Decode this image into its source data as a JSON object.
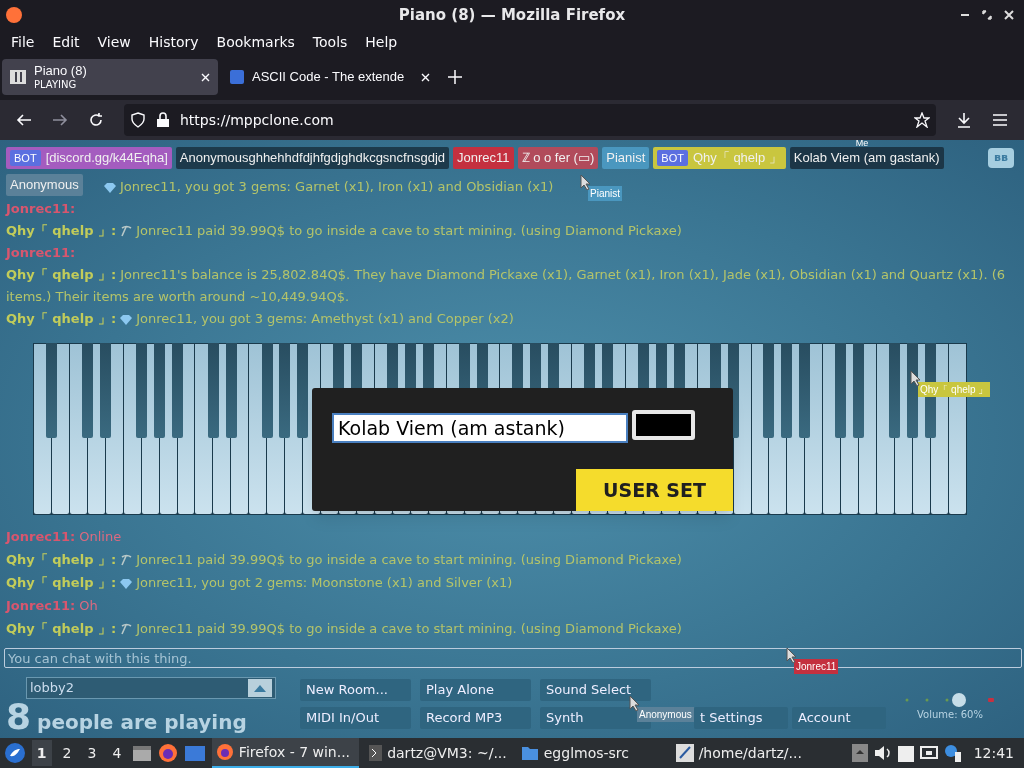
{
  "window": {
    "title": "Piano (8) — Mozilla Firefox"
  },
  "menu": [
    "File",
    "Edit",
    "View",
    "History",
    "Bookmarks",
    "Tools",
    "Help"
  ],
  "tabs": [
    {
      "title": "Piano (8)",
      "subtitle": "PLAYING",
      "selected": true
    },
    {
      "title": "ASCII Code - The extende",
      "selected": false
    }
  ],
  "url": "https://mppclone.com",
  "users": [
    {
      "name": "[discord.gg/k44Eqha]",
      "badge": "BOT",
      "color": "#a45cbf"
    },
    {
      "name": "Anonymousghhehhdfdjhfgdjghdkcgsncfnsgdjd",
      "color": "#1d3a4b"
    },
    {
      "name": "Jonrec11",
      "color": "#c4303f"
    },
    {
      "name": "ℤ o o fer (▭)",
      "color": "#b14b5b"
    },
    {
      "name": "Pianist",
      "color": "#4a97bf"
    },
    {
      "name": "Qhy「 qhelp 」",
      "badge": "BOT",
      "color": "#c9c63f"
    },
    {
      "name": "Kolab Viem (am gastank)",
      "color": "#1c3647",
      "me": "Me"
    },
    {
      "name": "Anonymous",
      "color": "#5b8199"
    }
  ],
  "user_menu_button": "ʙʙ",
  "chat_above": [
    {
      "kind": "gems",
      "text": "Jonrec11, you got 3 gems: Garnet (x1), Iron (x1) and Obsidian (x1)"
    },
    {
      "kind": "user",
      "author": "Jonrec11:"
    },
    {
      "kind": "mining",
      "author": "Qhy「 qhelp 」:",
      "text": "Jonrec11 paid 39.99Q$ to go inside a cave to start mining. (using Diamond Pickaxe)"
    },
    {
      "kind": "user",
      "author": "Jonrec11:"
    },
    {
      "kind": "bot",
      "author": "Qhy「 qhelp 」:",
      "text": "Jonrec11's balance is 25,802.84Q$. They have Diamond Pickaxe (x1), Garnet (x1), Iron (x1), Jade (x1), Obsidian (x1) and Quartz (x1). (6 items.) Their items are worth around ~10,449.94Q$."
    },
    {
      "kind": "gems",
      "author": "Qhy「 qhelp 」:",
      "text": "Jonrec11, you got 3 gems: Amethyst (x1) and Copper (x2)"
    }
  ],
  "chat_below": [
    {
      "kind": "user",
      "author": "Jonrec11:",
      "text": "Online"
    },
    {
      "kind": "mining",
      "author": "Qhy「 qhelp 」:",
      "text": "Jonrec11 paid 39.99Q$ to go inside a cave to start mining. (using Diamond Pickaxe)"
    },
    {
      "kind": "gems",
      "author": "Qhy「 qhelp 」:",
      "text": "Jonrec11, you got 2 gems: Moonstone (x1) and Silver (x1)"
    },
    {
      "kind": "user",
      "author": "Jonrec11:",
      "text": "Oh"
    },
    {
      "kind": "mining",
      "author": "Qhy「 qhelp 」:",
      "text": "Jonrec11 paid 39.99Q$ to go inside a cave to start mining. (using Diamond Pickaxe)"
    }
  ],
  "cursors": [
    {
      "label": "Pianist",
      "color": "#4a97bf"
    },
    {
      "label": "Qhy「 qhelp 」",
      "color": "#c9c63f"
    },
    {
      "label": "Jonrec11",
      "color": "#c4303f"
    },
    {
      "label": "Anonymous",
      "color": "#5b8199"
    }
  ],
  "dialog": {
    "name_value": "Kolab Viem (am astank)",
    "button": "USER SET"
  },
  "chat_input": {
    "placeholder": "You can chat with this thing."
  },
  "room": {
    "value": "lobby2"
  },
  "player_count": "8",
  "player_text": "people are playing",
  "buttons": [
    "New Room...",
    "Play Alone",
    "Sound Select",
    "MIDI In/Out",
    "Record MP3",
    "Synth",
    "t Settings",
    "Account"
  ],
  "volume": {
    "level": 0.6,
    "reading": "Volume: 60%"
  },
  "taskbar": {
    "workspaces": [
      {
        "label": "1",
        "selected": true
      },
      {
        "label": "2",
        "selected": false
      },
      {
        "label": "3",
        "selected": false
      },
      {
        "label": "4",
        "selected": false
      }
    ],
    "tasks": [
      {
        "label": "Firefox - 7 win...",
        "selected": true
      },
      {
        "label": "dartz@VM3: ~/...",
        "selected": false
      },
      {
        "label": "egglmos-src",
        "selected": false
      },
      {
        "label": "/home/dartz/...",
        "selected": false
      }
    ],
    "clock": "12:41"
  }
}
